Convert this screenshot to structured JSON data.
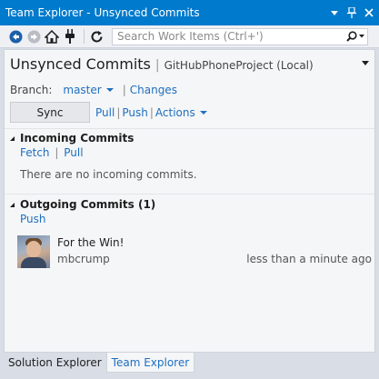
{
  "window": {
    "title": "Team Explorer - Unsynced Commits",
    "controls": [
      "dropdown",
      "pin",
      "close"
    ]
  },
  "toolbar": {
    "icons": [
      "back-icon",
      "forward-icon",
      "home-icon",
      "plug-icon",
      "refresh-icon"
    ],
    "search_placeholder": "Search Work Items (Ctrl+')"
  },
  "header": {
    "title": "Unsynced Commits",
    "separator": "|",
    "subtitle": "GitHubPhoneProject (Local)"
  },
  "branch": {
    "label": "Branch:",
    "value": "master",
    "changes_link": "Changes"
  },
  "actions": {
    "sync": "Sync",
    "pull": "Pull",
    "push": "Push",
    "actions": "Actions"
  },
  "incoming": {
    "title": "Incoming Commits",
    "links": [
      "Fetch",
      "Pull"
    ],
    "empty_text": "There are no incoming commits."
  },
  "outgoing": {
    "title": "Outgoing Commits (1)",
    "link": "Push",
    "commits": [
      {
        "message": "For the Win!",
        "author": "mbcrump",
        "time": "less than a minute ago"
      }
    ]
  },
  "tabs": [
    {
      "label": "Solution Explorer",
      "active": false
    },
    {
      "label": "Team Explorer",
      "active": true
    }
  ],
  "colors": {
    "accent": "#007acc",
    "link": "#1e6fc1"
  }
}
